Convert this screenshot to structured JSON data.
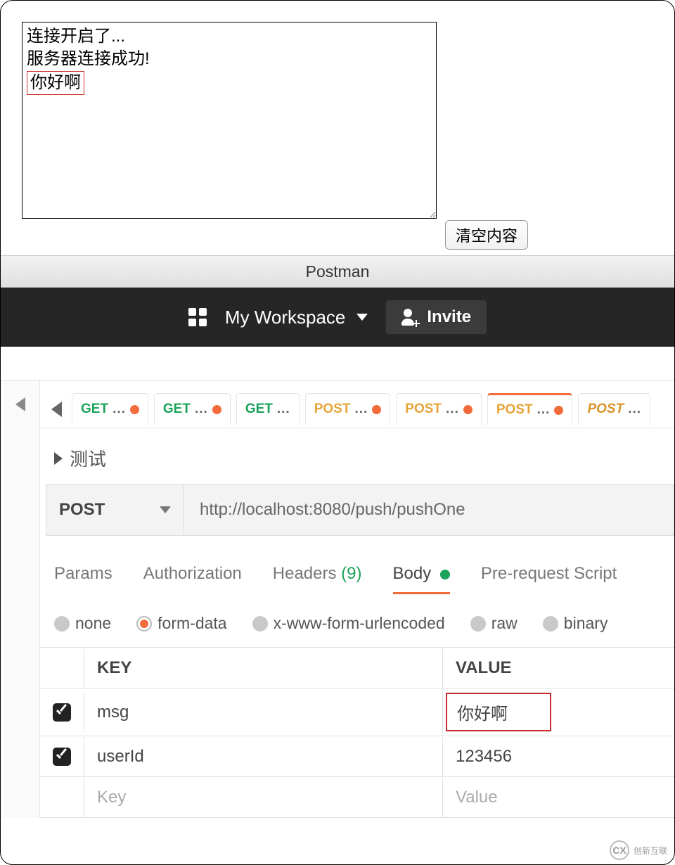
{
  "output_box": {
    "lines": [
      "连接开启了...",
      "服务器连接成功!",
      "你好啊"
    ],
    "highlighted_line_index": 2
  },
  "clear_button": "清空内容",
  "window_title": "Postman",
  "header": {
    "workspace_label": "My Workspace",
    "invite_label": "Invite"
  },
  "tabs": [
    {
      "method": "GET",
      "indicator": true,
      "active": false
    },
    {
      "method": "GET",
      "indicator": true,
      "active": false
    },
    {
      "method": "GET",
      "indicator": false,
      "active": false
    },
    {
      "method": "POST",
      "indicator": true,
      "active": false
    },
    {
      "method": "POST",
      "indicator": true,
      "active": false
    },
    {
      "method": "POST",
      "indicator": true,
      "active": true
    },
    {
      "method": "POST",
      "indicator": false,
      "active": false,
      "italic": true
    }
  ],
  "breadcrumb": "测试",
  "request": {
    "method": "POST",
    "url": "http://localhost:8080/push/pushOne"
  },
  "subtabs": {
    "params": "Params",
    "authorization": "Authorization",
    "headers": "Headers",
    "headers_count": "(9)",
    "body": "Body",
    "pre_request": "Pre-request Script",
    "active": "body"
  },
  "body_types": {
    "none": "none",
    "form_data": "form-data",
    "xwww": "x-www-form-urlencoded",
    "raw": "raw",
    "binary": "binary",
    "selected": "form_data"
  },
  "form_table": {
    "key_header": "KEY",
    "value_header": "VALUE",
    "rows": [
      {
        "checked": true,
        "key": "msg",
        "value": "你好啊",
        "highlight_value": true
      },
      {
        "checked": true,
        "key": "userId",
        "value": "123456",
        "highlight_value": false
      }
    ],
    "placeholder_key": "Key",
    "placeholder_value": "Value"
  },
  "watermark": "创新互联"
}
